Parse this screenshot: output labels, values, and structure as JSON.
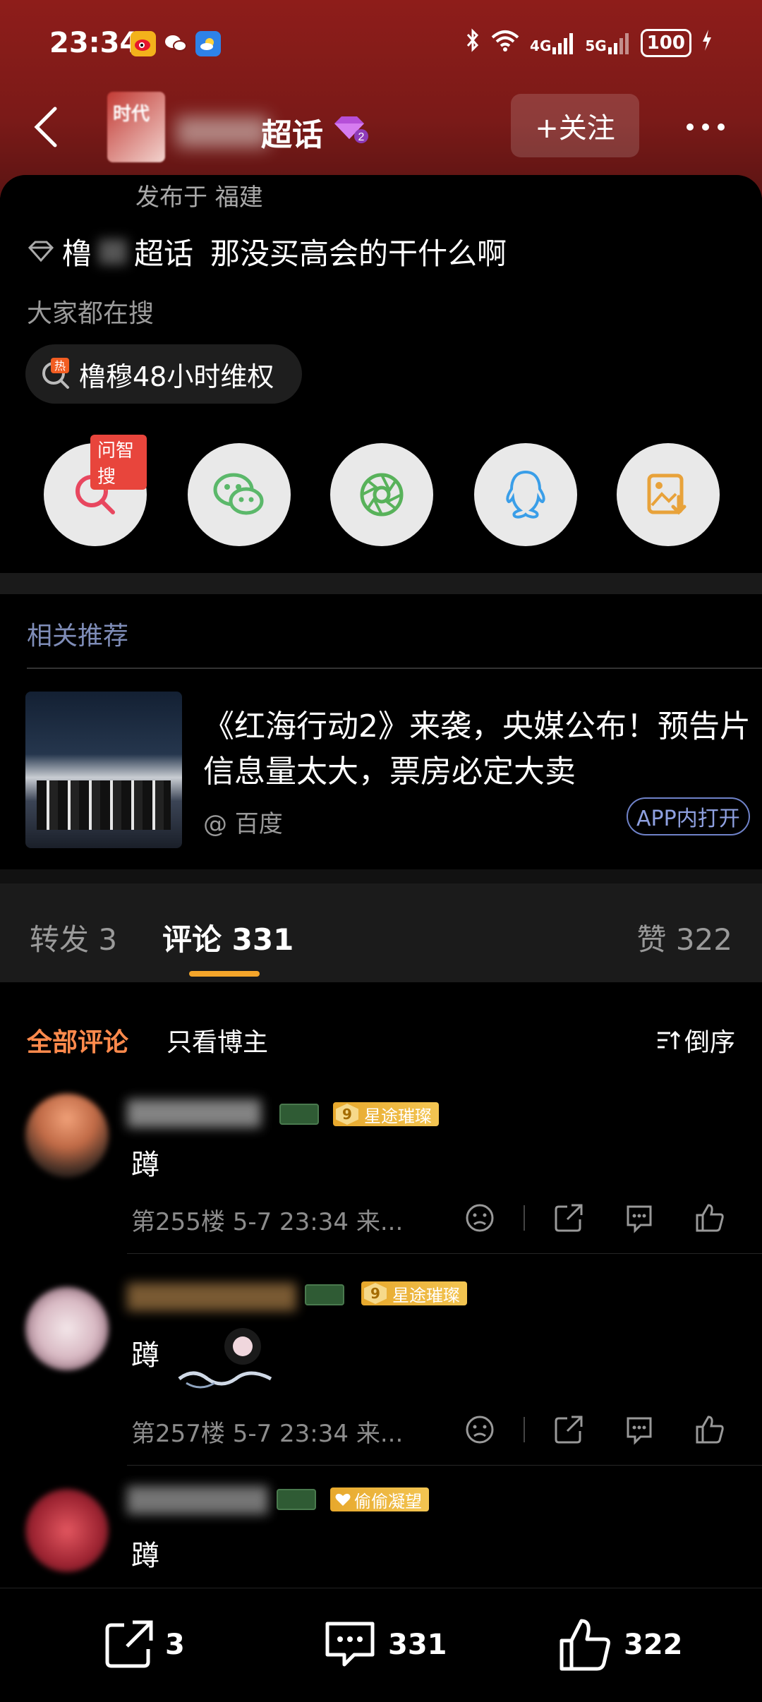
{
  "status_bar": {
    "time": "23:34",
    "network_4g": "4G",
    "network_5g": "5G",
    "battery": "100"
  },
  "header": {
    "avatar_text": "时代",
    "title_suffix": "超话",
    "follow_label": "+关注"
  },
  "post": {
    "published": "发布于 福建",
    "topic_prefix": "橹",
    "topic_suffix": "超话",
    "topic_text": "那没买高会的干什么啊"
  },
  "search": {
    "label": "大家都在搜",
    "hot_icon_text": "热",
    "hot_query": "橹穆48小时维权"
  },
  "share": {
    "ai_search_badge": "问智搜",
    "items": [
      "search-ai-icon",
      "wechat-icon",
      "moments-icon",
      "qq-icon",
      "save-image-icon"
    ]
  },
  "recommend": {
    "section_label": "相关推荐",
    "title": "《红海行动2》来袭，央媒公布！预告片信息量太大，票房必定大卖",
    "source": "@ 百度",
    "open_label": "APP内打开"
  },
  "tabs": {
    "repost": "转发 3",
    "comments": "评论 331",
    "likes": "赞 322"
  },
  "filter": {
    "all": "全部评论",
    "op_only": "只看博主",
    "sort": "倒序"
  },
  "comments": [
    {
      "badge_level": "9",
      "badge": "星途璀璨",
      "text": "蹲",
      "meta": "第255楼 5-7 23:34 来..."
    },
    {
      "badge_level": "9",
      "badge": "星途璀璨",
      "text": "蹲",
      "meta": "第257楼 5-7 23:34 来..."
    },
    {
      "badge_level": "",
      "badge": "偷偷凝望",
      "text": "蹲",
      "meta": ""
    }
  ],
  "bottom_bar": {
    "repost_count": "3",
    "comment_count": "331",
    "like_count": "322"
  },
  "colors": {
    "header_red": "#8e1d1a",
    "accent_orange": "#ff8a4c",
    "tab_underline": "#f4a52a",
    "link_blue": "#8ea0e0"
  }
}
